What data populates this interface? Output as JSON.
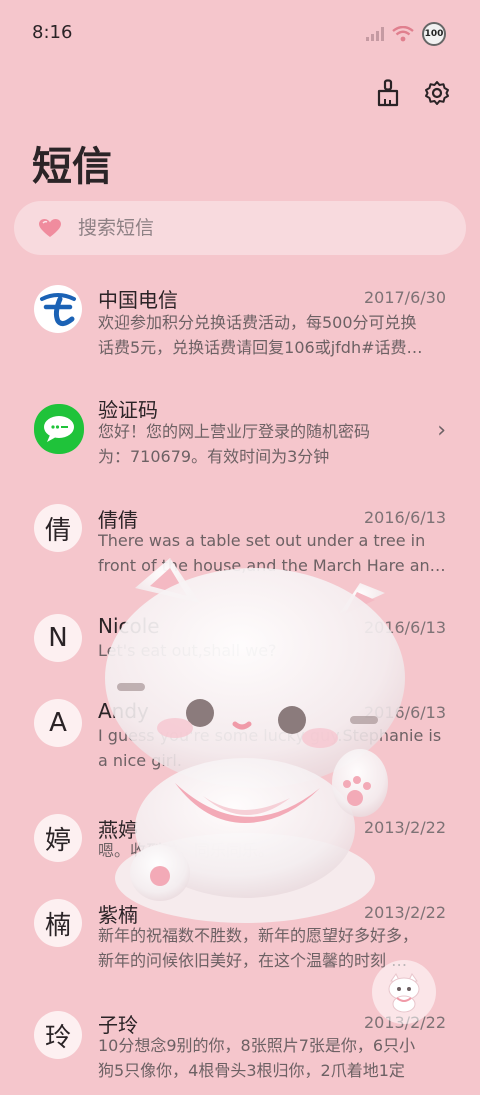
{
  "status": {
    "time": "8:16",
    "battery": "100"
  },
  "header": {
    "title": "短信"
  },
  "search": {
    "placeholder": "搜索短信"
  },
  "messages": [
    {
      "name": "中国电信",
      "date": "2017/6/30",
      "avatar": "",
      "line1": "欢迎参加积分兑换话费活动，每500分可兑换",
      "line2": "话费5元，兑换话费请回复106或jfdh#话费…"
    },
    {
      "name": "验证码",
      "date": "",
      "avatar": "",
      "line1": "您好！您的网上营业厅登录的随机密码",
      "line2": "为：710679。有效时间为3分钟"
    },
    {
      "name": "倩倩",
      "date": "2016/6/13",
      "avatar": "倩",
      "line1": "There was a table set out under a tree in",
      "line2": "front of the house,and the March Hare an…"
    },
    {
      "name": "Nicole",
      "date": "2016/6/13",
      "avatar": "N",
      "line1": "Let's eat out,shall we?",
      "line2": ""
    },
    {
      "name": "Andy",
      "date": "2016/6/13",
      "avatar": "A",
      "line1": "I guess you're some lucky guy.Stephanie is",
      "line2": "a nice girl."
    },
    {
      "name": "燕婷",
      "date": "2013/2/22",
      "avatar": "婷",
      "line1": "嗯。收到啦。同乐同乐。",
      "line2": ""
    },
    {
      "name": "紫楠",
      "date": "2013/2/22",
      "avatar": "楠",
      "line1": "新年的祝福数不胜数，新年的愿望好多好多，",
      "line2": "新年的问候依旧美好，在这个温馨的时刻 …"
    },
    {
      "name": "子玲",
      "date": "2013/2/22",
      "avatar": "玲",
      "line1": "10分想念9别的你，8张照片7张是你，6只小",
      "line2": "狗5只像你，4根骨头3根归你，2爪着地1定"
    }
  ],
  "colors": {
    "background": "#f5c6cc",
    "telecom_blue": "#1b62b5",
    "sms_green": "#1fc33a"
  }
}
